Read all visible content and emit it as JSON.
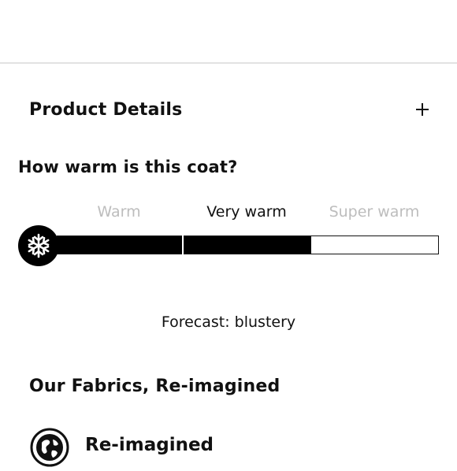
{
  "product_details": {
    "title": "Product Details",
    "toggle_icon": "plus-icon"
  },
  "warmth": {
    "title": "How warm is this coat?",
    "levels": [
      "Warm",
      "Very warm",
      "Super warm"
    ],
    "selected_index": 1,
    "meter_fill_fraction": 0.667,
    "icon": "snowflake-icon",
    "forecast": "Forecast: blustery"
  },
  "fabrics": {
    "title": "Our Fabrics, Re-imagined",
    "items": [
      {
        "icon": "recycled-globe-icon",
        "label": "Re-imagined"
      }
    ]
  },
  "colors": {
    "text": "#111111",
    "muted": "#bdbdbd",
    "meter_fill": "#000000",
    "divider": "#e2e2e2"
  }
}
